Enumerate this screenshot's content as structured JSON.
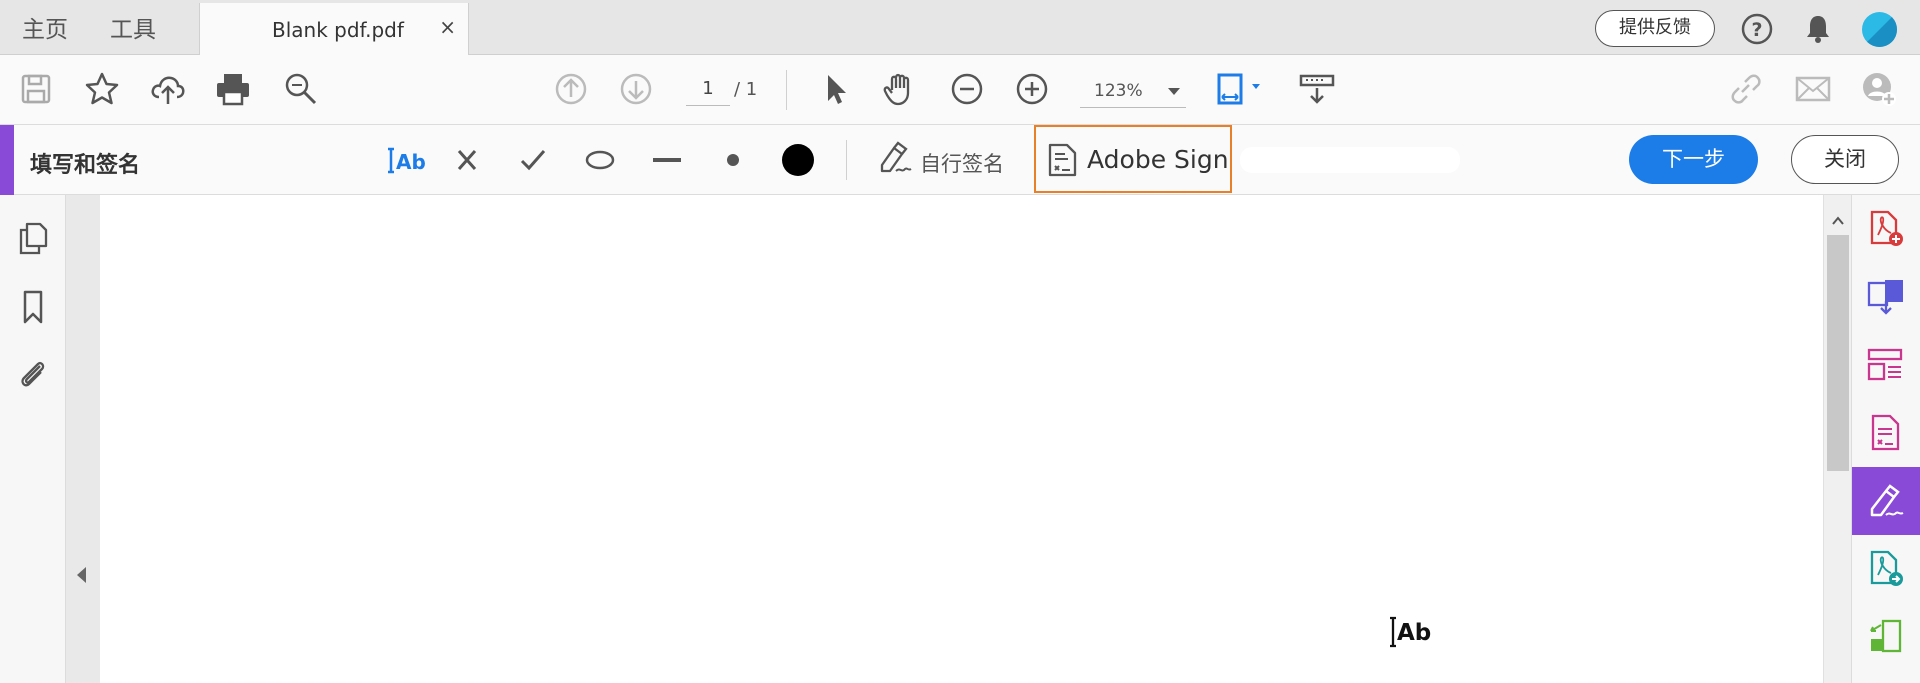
{
  "tabbar": {
    "home_label": "主页",
    "tools_label": "工具",
    "doc_tab_name": "Blank pdf.pdf",
    "doc_tab_close": "×",
    "feedback_label": "提供反馈",
    "help_icon": "help-icon",
    "bell_icon": "bell-icon"
  },
  "toolbar": {
    "page_current": "1",
    "page_total": "/ 1",
    "zoom_value": "123%"
  },
  "signbar": {
    "title": "填写和签名",
    "text_tool_label": "Ab",
    "self_sign_label": "自行签名",
    "adobe_sign_label": "Adobe Sign",
    "next_label": "下一步",
    "close_label": "关闭"
  },
  "document": {
    "cursor_label": "Ab"
  },
  "colors": {
    "accent_purple": "#8a4ad8",
    "primary_blue": "#1c7ce8",
    "highlight_orange": "#e8802a",
    "icon_red": "#d83b3b",
    "icon_pink": "#c8368f",
    "icon_teal": "#1a9a9a",
    "icon_green": "#5fb535",
    "icon_violet": "#5a5ad8"
  }
}
